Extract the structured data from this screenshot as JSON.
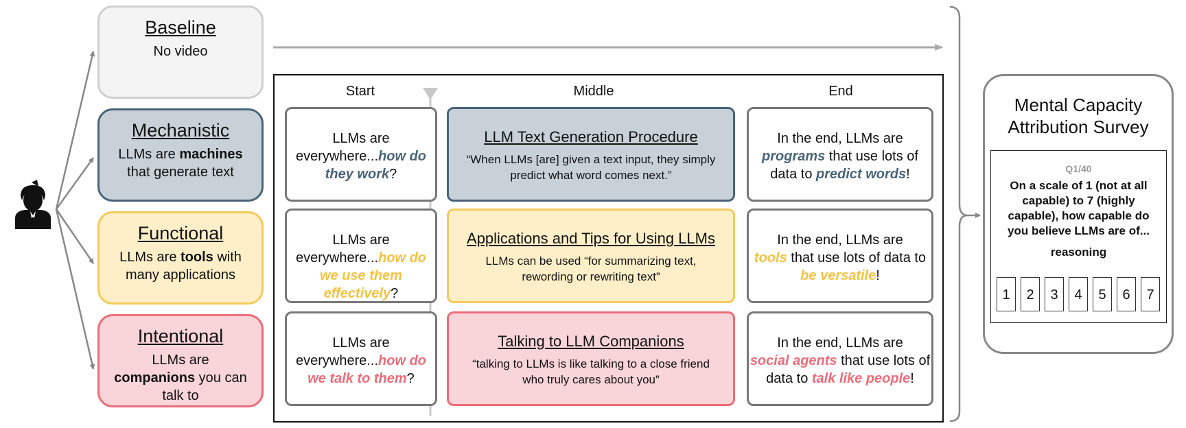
{
  "conditions": [
    {
      "title": "Baseline",
      "desc_parts": [
        "No video"
      ],
      "bg": "#f4f4f4",
      "border": "#cfcfcf"
    },
    {
      "title": "Mechanistic",
      "desc_parts": [
        "LLMs are ",
        "machines",
        " that generate text"
      ],
      "bg": "#c8d1d8",
      "border": "#4a6478"
    },
    {
      "title": "Functional",
      "desc_parts": [
        "LLMs are ",
        "tools",
        " with many applications"
      ],
      "bg": "#feefc8",
      "border": "#f5c95a"
    },
    {
      "title": "Intentional",
      "desc_parts": [
        "LLMs are ",
        "companions",
        " you can talk to"
      ],
      "bg": "#f9d4d8",
      "border": "#ec6c7a"
    }
  ],
  "columns": {
    "start": "Start",
    "middle": "Middle",
    "end": "End"
  },
  "rows": [
    {
      "color": "#4a6478",
      "start": [
        "LLMs are",
        "everywhere...",
        "how do they work",
        "?"
      ],
      "middle_title": "LLM Text Generation Procedure",
      "middle_quote": "“When LLMs [are] given a text input, they simply predict what word comes next.”",
      "middle_bg": "#c8d1d8",
      "middle_border": "#4a6478",
      "end": [
        "In the end, LLMs are",
        "programs",
        " that use lots of data to ",
        "predict words",
        "!"
      ]
    },
    {
      "color": "#f5c242",
      "start": [
        "LLMs are",
        "everywhere...",
        "how do we use them effectively",
        "?"
      ],
      "middle_title": "Applications and Tips for Using LLMs",
      "middle_quote": "LLMs can be used “for summarizing text, rewording or rewriting text”",
      "middle_bg": "#feefc8",
      "middle_border": "#f5c95a",
      "end": [
        "In the end, LLMs are",
        "tools",
        " that use lots of data to ",
        "be versatile",
        "!"
      ]
    },
    {
      "color": "#ec6c7a",
      "start": [
        "LLMs are",
        "everywhere...",
        "how do we talk to them",
        "?"
      ],
      "middle_title": "Talking to LLM Companions",
      "middle_quote": "“talking to LLMs is like talking to a close friend who truly cares about you”",
      "middle_bg": "#f9d4d8",
      "middle_border": "#ec6c7a",
      "end": [
        "In the end, LLMs are",
        "social agents",
        " that use lots of data to ",
        "talk like people",
        "!"
      ]
    }
  ],
  "survey": {
    "title_line1": "Mental Capacity",
    "title_line2": "Attribution Survey",
    "qnum": "Q1/40",
    "question": "On a scale of 1 (not at all capable) to 7 (highly capable), how capable do you believe LLMs are of...",
    "trait": "reasoning",
    "options": [
      "1",
      "2",
      "3",
      "4",
      "5",
      "6",
      "7"
    ]
  }
}
